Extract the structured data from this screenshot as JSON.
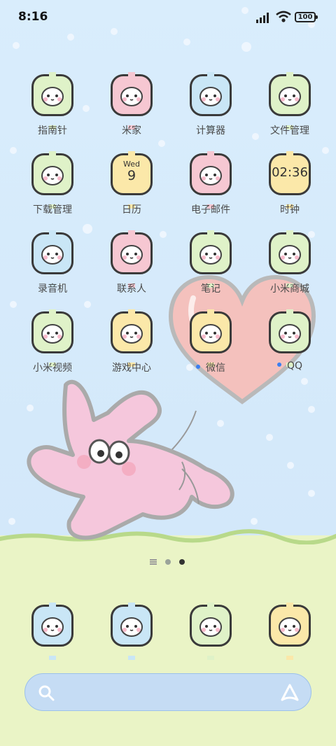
{
  "status": {
    "time": "8:16",
    "battery": "100"
  },
  "apps": [
    {
      "label": "指南针",
      "icon": "compass-icon",
      "bg": "#dff2c8"
    },
    {
      "label": "米家",
      "icon": "mijia-icon",
      "bg": "#f6c7d2"
    },
    {
      "label": "计算器",
      "icon": "calculator-icon",
      "bg": "#c9e6f6"
    },
    {
      "label": "文件管理",
      "icon": "file-manager-icon",
      "bg": "#dff2c8"
    },
    {
      "label": "下载管理",
      "icon": "download-icon",
      "bg": "#dff2c8"
    },
    {
      "label": "日历",
      "icon": "calendar-icon",
      "bg": "#fbe8a9"
    },
    {
      "label": "电子邮件",
      "icon": "email-icon",
      "bg": "#f6c7d2"
    },
    {
      "label": "时钟",
      "icon": "clock-icon",
      "bg": "#fbe8a9"
    },
    {
      "label": "录音机",
      "icon": "recorder-icon",
      "bg": "#c9e6f6"
    },
    {
      "label": "联系人",
      "icon": "contacts-icon",
      "bg": "#f6c7d2"
    },
    {
      "label": "笔记",
      "icon": "notes-icon",
      "bg": "#dff2c8"
    },
    {
      "label": "小米商城",
      "icon": "mi-store-icon",
      "bg": "#dff2c8"
    },
    {
      "label": "小米视频",
      "icon": "mi-video-icon",
      "bg": "#dff2c8"
    },
    {
      "label": "游戏中心",
      "icon": "game-center-icon",
      "bg": "#fbe8a9"
    },
    {
      "label": "微信",
      "icon": "wechat-icon",
      "bg": "#fbe8a9",
      "new": true
    },
    {
      "label": "QQ",
      "icon": "qq-icon",
      "bg": "#dff2c8",
      "new": true
    }
  ],
  "calendar": {
    "weekday": "Wed",
    "day": "9"
  },
  "clock": {
    "time": "02:36"
  },
  "pager": {
    "pages": 2,
    "current": 2
  },
  "dock": [
    {
      "icon": "phone-icon",
      "bg": "#c9e6f6"
    },
    {
      "icon": "messages-icon",
      "bg": "#c9e6f6"
    },
    {
      "icon": "browser-icon",
      "bg": "#dff2c8"
    },
    {
      "icon": "camera-icon",
      "bg": "#fbe8a9"
    }
  ],
  "search": {
    "icon_left": "search-icon",
    "icon_right": "ai-assistant-icon"
  }
}
